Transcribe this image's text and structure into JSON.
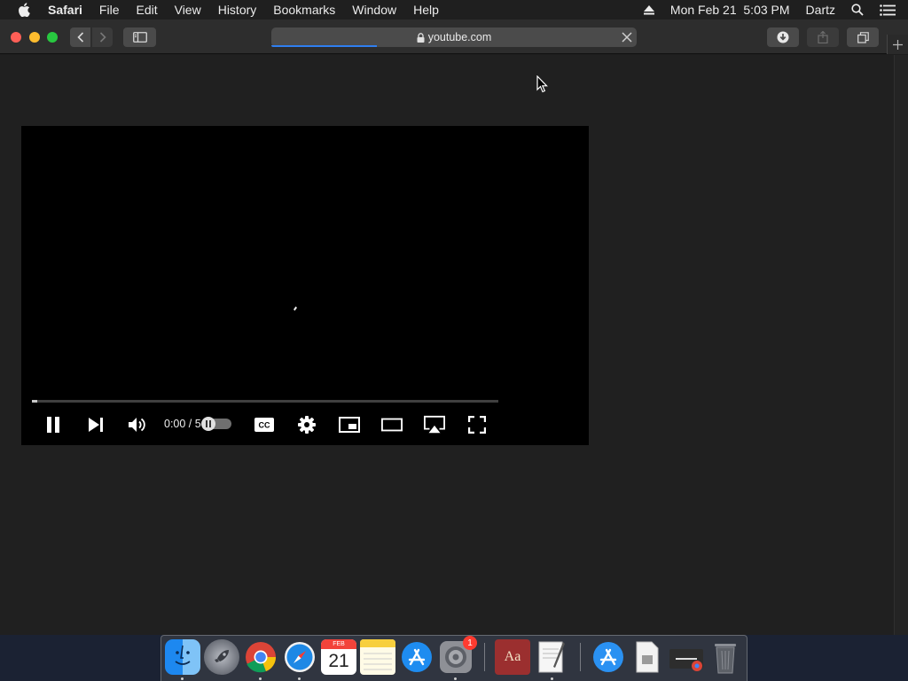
{
  "menubar": {
    "app_name": "Safari",
    "items": [
      "File",
      "Edit",
      "View",
      "History",
      "Bookmarks",
      "Window",
      "Help"
    ],
    "clock": "Mon Feb 21  5:03 PM",
    "user": "Dartz"
  },
  "browser": {
    "address": "youtube.com",
    "load_progress": 0.29
  },
  "player": {
    "state": "loading",
    "time_display": "0:00 / 5",
    "seek_fraction": 0.0,
    "autoplay": "paused"
  },
  "dock": {
    "calendar_month": "FEB",
    "calendar_day": "21",
    "dictionary_label": "Aa",
    "system_prefs_badge": "1"
  },
  "colors": {
    "accent": "#2f7ff0",
    "close": "#fe5f57",
    "minimize": "#febc2e",
    "maximize": "#28c840",
    "badge": "#ff3b30"
  }
}
